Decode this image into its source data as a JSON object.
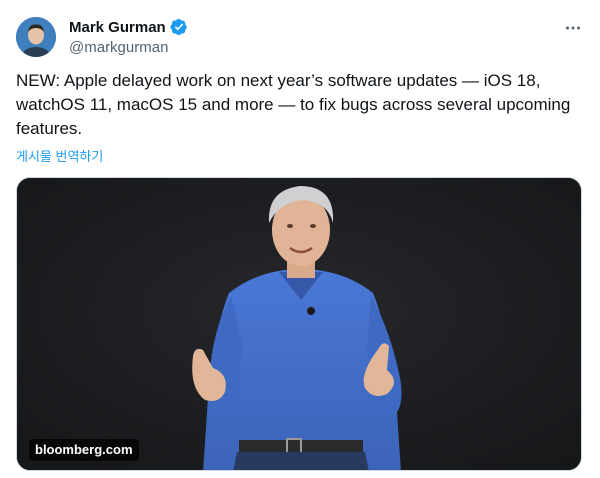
{
  "author": {
    "display_name": "Mark Gurman",
    "handle": "@markgurman",
    "verified": true
  },
  "tweet": {
    "text": "NEW: Apple delayed work on next year’s software updates — iOS 18, watchOS 11, macOS 15 and more — to fix bugs across several upcoming features.",
    "translate_label": "게시물 번역하기"
  },
  "media": {
    "source_label": "bloomberg.com"
  },
  "icons": {
    "verified": "verified-badge-icon",
    "more": "more-options-icon"
  },
  "colors": {
    "link": "#1d9bf0",
    "verified": "#1d9bf0",
    "secondary_text": "#536471"
  }
}
